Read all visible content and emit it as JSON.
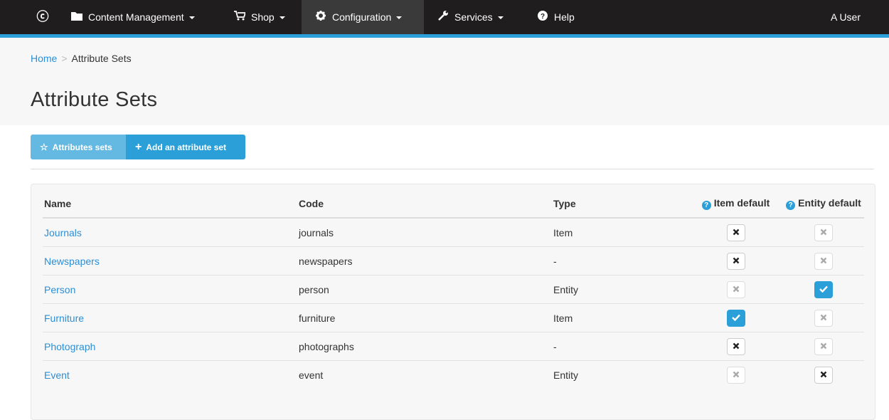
{
  "nav": {
    "logo": "ⓒ",
    "items": [
      {
        "label": "Content Management",
        "icon": "folder-icon",
        "glyph": "📂"
      },
      {
        "label": "Shop",
        "icon": "cart-icon",
        "glyph": "🛒"
      },
      {
        "label": "Configuration",
        "icon": "gear-icon",
        "glyph": "⚙"
      },
      {
        "label": "Services",
        "icon": "wrench-icon",
        "glyph": "🔧"
      },
      {
        "label": "Help",
        "icon": "help-icon",
        "glyph": "?"
      }
    ],
    "user": "A User"
  },
  "breadcrumb": {
    "home": "Home",
    "separator": ">",
    "current": "Attribute Sets"
  },
  "page_title": "Attribute Sets",
  "buttons": {
    "sets_label": "Attributes sets",
    "add_label": "Add an attribute set"
  },
  "table": {
    "headers": {
      "name": "Name",
      "code": "Code",
      "type": "Type",
      "item_default": "Item default",
      "entity_default": "Entity default"
    },
    "rows": [
      {
        "name": "Journals",
        "code": "journals",
        "type": "Item",
        "item_default": "x-dark",
        "entity_default": "x-light"
      },
      {
        "name": "Newspapers",
        "code": "newspapers",
        "type": "-",
        "item_default": "x-dark",
        "entity_default": "x-light"
      },
      {
        "name": "Person",
        "code": "person",
        "type": "Entity",
        "item_default": "x-light",
        "entity_default": "check"
      },
      {
        "name": "Furniture",
        "code": "furniture",
        "type": "Item",
        "item_default": "check",
        "entity_default": "x-light"
      },
      {
        "name": "Photograph",
        "code": "photographs",
        "type": "-",
        "item_default": "x-dark",
        "entity_default": "x-light"
      },
      {
        "name": "Event",
        "code": "event",
        "type": "Entity",
        "item_default": "x-light",
        "entity_default": "x-dark"
      }
    ]
  },
  "colors": {
    "accent": "#2a9fd8",
    "navbar": "#1f1d1e",
    "link": "#2b8fd6"
  }
}
